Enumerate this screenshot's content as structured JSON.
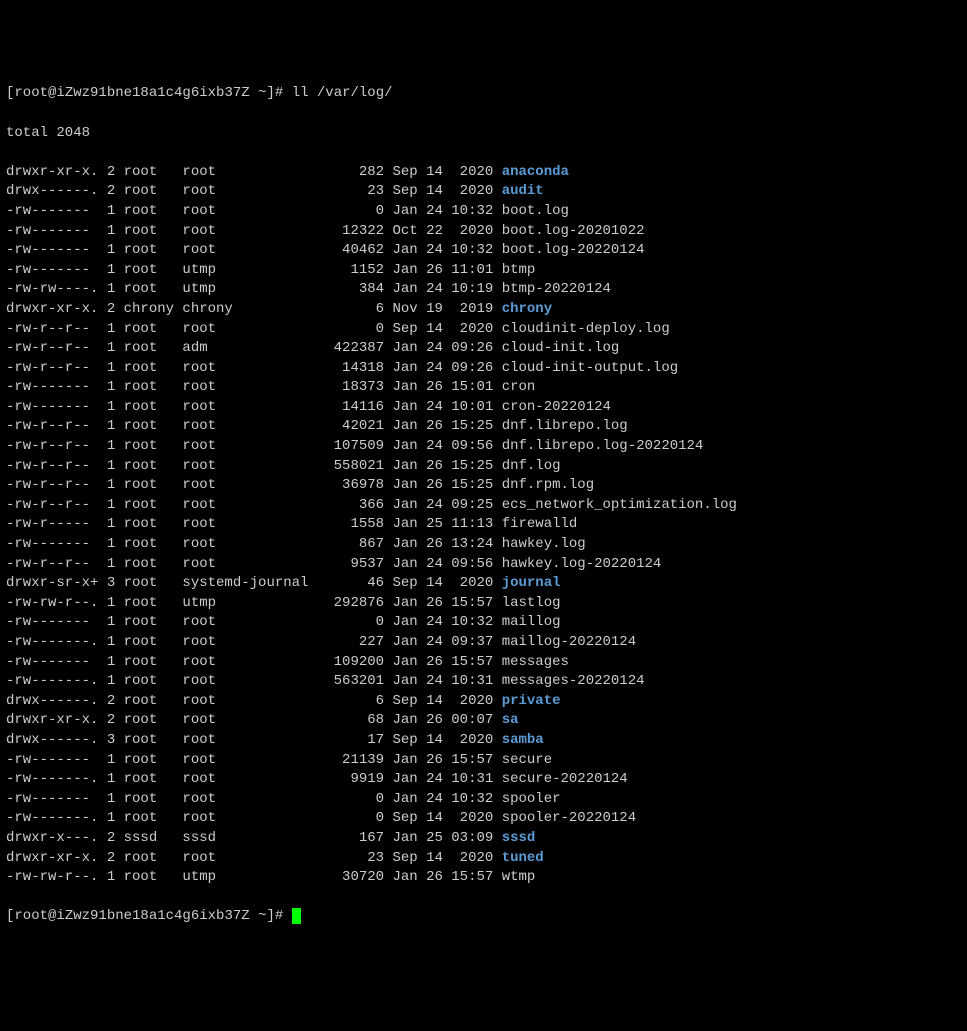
{
  "prompt": {
    "open": "[",
    "user_host": "root@iZwz91bne18a1c4g6ixb37Z",
    "path": " ~",
    "close": "]# ",
    "command": "ll /var/log/"
  },
  "total_line": "total 2048",
  "rows": [
    {
      "perms": "drwxr-xr-x.",
      "links": "2",
      "owner": "root",
      "group": "root",
      "size": "282",
      "month": "Sep",
      "day": "14",
      "time": "2020",
      "name": "anaconda",
      "isdir": true
    },
    {
      "perms": "drwx------.",
      "links": "2",
      "owner": "root",
      "group": "root",
      "size": "23",
      "month": "Sep",
      "day": "14",
      "time": "2020",
      "name": "audit",
      "isdir": true
    },
    {
      "perms": "-rw-------",
      "links": "1",
      "owner": "root",
      "group": "root",
      "size": "0",
      "month": "Jan",
      "day": "24",
      "time": "10:32",
      "name": "boot.log",
      "isdir": false
    },
    {
      "perms": "-rw-------",
      "links": "1",
      "owner": "root",
      "group": "root",
      "size": "12322",
      "month": "Oct",
      "day": "22",
      "time": "2020",
      "name": "boot.log-20201022",
      "isdir": false
    },
    {
      "perms": "-rw-------",
      "links": "1",
      "owner": "root",
      "group": "root",
      "size": "40462",
      "month": "Jan",
      "day": "24",
      "time": "10:32",
      "name": "boot.log-20220124",
      "isdir": false
    },
    {
      "perms": "-rw-------",
      "links": "1",
      "owner": "root",
      "group": "utmp",
      "size": "1152",
      "month": "Jan",
      "day": "26",
      "time": "11:01",
      "name": "btmp",
      "isdir": false
    },
    {
      "perms": "-rw-rw----.",
      "links": "1",
      "owner": "root",
      "group": "utmp",
      "size": "384",
      "month": "Jan",
      "day": "24",
      "time": "10:19",
      "name": "btmp-20220124",
      "isdir": false
    },
    {
      "perms": "drwxr-xr-x.",
      "links": "2",
      "owner": "chrony",
      "group": "chrony",
      "size": "6",
      "month": "Nov",
      "day": "19",
      "time": "2019",
      "name": "chrony",
      "isdir": true
    },
    {
      "perms": "-rw-r--r--",
      "links": "1",
      "owner": "root",
      "group": "root",
      "size": "0",
      "month": "Sep",
      "day": "14",
      "time": "2020",
      "name": "cloudinit-deploy.log",
      "isdir": false
    },
    {
      "perms": "-rw-r--r--",
      "links": "1",
      "owner": "root",
      "group": "adm",
      "size": "422387",
      "month": "Jan",
      "day": "24",
      "time": "09:26",
      "name": "cloud-init.log",
      "isdir": false
    },
    {
      "perms": "-rw-r--r--",
      "links": "1",
      "owner": "root",
      "group": "root",
      "size": "14318",
      "month": "Jan",
      "day": "24",
      "time": "09:26",
      "name": "cloud-init-output.log",
      "isdir": false
    },
    {
      "perms": "-rw-------",
      "links": "1",
      "owner": "root",
      "group": "root",
      "size": "18373",
      "month": "Jan",
      "day": "26",
      "time": "15:01",
      "name": "cron",
      "isdir": false
    },
    {
      "perms": "-rw-------",
      "links": "1",
      "owner": "root",
      "group": "root",
      "size": "14116",
      "month": "Jan",
      "day": "24",
      "time": "10:01",
      "name": "cron-20220124",
      "isdir": false
    },
    {
      "perms": "-rw-r--r--",
      "links": "1",
      "owner": "root",
      "group": "root",
      "size": "42021",
      "month": "Jan",
      "day": "26",
      "time": "15:25",
      "name": "dnf.librepo.log",
      "isdir": false
    },
    {
      "perms": "-rw-r--r--",
      "links": "1",
      "owner": "root",
      "group": "root",
      "size": "107509",
      "month": "Jan",
      "day": "24",
      "time": "09:56",
      "name": "dnf.librepo.log-20220124",
      "isdir": false
    },
    {
      "perms": "-rw-r--r--",
      "links": "1",
      "owner": "root",
      "group": "root",
      "size": "558021",
      "month": "Jan",
      "day": "26",
      "time": "15:25",
      "name": "dnf.log",
      "isdir": false
    },
    {
      "perms": "-rw-r--r--",
      "links": "1",
      "owner": "root",
      "group": "root",
      "size": "36978",
      "month": "Jan",
      "day": "26",
      "time": "15:25",
      "name": "dnf.rpm.log",
      "isdir": false
    },
    {
      "perms": "-rw-r--r--",
      "links": "1",
      "owner": "root",
      "group": "root",
      "size": "366",
      "month": "Jan",
      "day": "24",
      "time": "09:25",
      "name": "ecs_network_optimization.log",
      "isdir": false
    },
    {
      "perms": "-rw-r-----",
      "links": "1",
      "owner": "root",
      "group": "root",
      "size": "1558",
      "month": "Jan",
      "day": "25",
      "time": "11:13",
      "name": "firewalld",
      "isdir": false
    },
    {
      "perms": "-rw-------",
      "links": "1",
      "owner": "root",
      "group": "root",
      "size": "867",
      "month": "Jan",
      "day": "26",
      "time": "13:24",
      "name": "hawkey.log",
      "isdir": false
    },
    {
      "perms": "-rw-r--r--",
      "links": "1",
      "owner": "root",
      "group": "root",
      "size": "9537",
      "month": "Jan",
      "day": "24",
      "time": "09:56",
      "name": "hawkey.log-20220124",
      "isdir": false
    },
    {
      "perms": "drwxr-sr-x+",
      "links": "3",
      "owner": "root",
      "group": "systemd-journal",
      "size": "46",
      "month": "Sep",
      "day": "14",
      "time": "2020",
      "name": "journal",
      "isdir": true
    },
    {
      "perms": "-rw-rw-r--.",
      "links": "1",
      "owner": "root",
      "group": "utmp",
      "size": "292876",
      "month": "Jan",
      "day": "26",
      "time": "15:57",
      "name": "lastlog",
      "isdir": false
    },
    {
      "perms": "-rw-------",
      "links": "1",
      "owner": "root",
      "group": "root",
      "size": "0",
      "month": "Jan",
      "day": "24",
      "time": "10:32",
      "name": "maillog",
      "isdir": false
    },
    {
      "perms": "-rw-------.",
      "links": "1",
      "owner": "root",
      "group": "root",
      "size": "227",
      "month": "Jan",
      "day": "24",
      "time": "09:37",
      "name": "maillog-20220124",
      "isdir": false
    },
    {
      "perms": "-rw-------",
      "links": "1",
      "owner": "root",
      "group": "root",
      "size": "109200",
      "month": "Jan",
      "day": "26",
      "time": "15:57",
      "name": "messages",
      "isdir": false
    },
    {
      "perms": "-rw-------.",
      "links": "1",
      "owner": "root",
      "group": "root",
      "size": "563201",
      "month": "Jan",
      "day": "24",
      "time": "10:31",
      "name": "messages-20220124",
      "isdir": false
    },
    {
      "perms": "drwx------.",
      "links": "2",
      "owner": "root",
      "group": "root",
      "size": "6",
      "month": "Sep",
      "day": "14",
      "time": "2020",
      "name": "private",
      "isdir": true
    },
    {
      "perms": "drwxr-xr-x.",
      "links": "2",
      "owner": "root",
      "group": "root",
      "size": "68",
      "month": "Jan",
      "day": "26",
      "time": "00:07",
      "name": "sa",
      "isdir": true
    },
    {
      "perms": "drwx------.",
      "links": "3",
      "owner": "root",
      "group": "root",
      "size": "17",
      "month": "Sep",
      "day": "14",
      "time": "2020",
      "name": "samba",
      "isdir": true
    },
    {
      "perms": "-rw-------",
      "links": "1",
      "owner": "root",
      "group": "root",
      "size": "21139",
      "month": "Jan",
      "day": "26",
      "time": "15:57",
      "name": "secure",
      "isdir": false
    },
    {
      "perms": "-rw-------.",
      "links": "1",
      "owner": "root",
      "group": "root",
      "size": "9919",
      "month": "Jan",
      "day": "24",
      "time": "10:31",
      "name": "secure-20220124",
      "isdir": false
    },
    {
      "perms": "-rw-------",
      "links": "1",
      "owner": "root",
      "group": "root",
      "size": "0",
      "month": "Jan",
      "day": "24",
      "time": "10:32",
      "name": "spooler",
      "isdir": false
    },
    {
      "perms": "-rw-------.",
      "links": "1",
      "owner": "root",
      "group": "root",
      "size": "0",
      "month": "Sep",
      "day": "14",
      "time": "2020",
      "name": "spooler-20220124",
      "isdir": false
    },
    {
      "perms": "drwxr-x---.",
      "links": "2",
      "owner": "sssd",
      "group": "sssd",
      "size": "167",
      "month": "Jan",
      "day": "25",
      "time": "03:09",
      "name": "sssd",
      "isdir": true
    },
    {
      "perms": "drwxr-xr-x.",
      "links": "2",
      "owner": "root",
      "group": "root",
      "size": "23",
      "month": "Sep",
      "day": "14",
      "time": "2020",
      "name": "tuned",
      "isdir": true
    },
    {
      "perms": "-rw-rw-r--.",
      "links": "1",
      "owner": "root",
      "group": "utmp",
      "size": "30720",
      "month": "Jan",
      "day": "26",
      "time": "15:57",
      "name": "wtmp",
      "isdir": false
    }
  ],
  "prompt2": {
    "open": "[",
    "user_host": "root@iZwz91bne18a1c4g6ixb37Z",
    "path": " ~",
    "close": "]# "
  }
}
